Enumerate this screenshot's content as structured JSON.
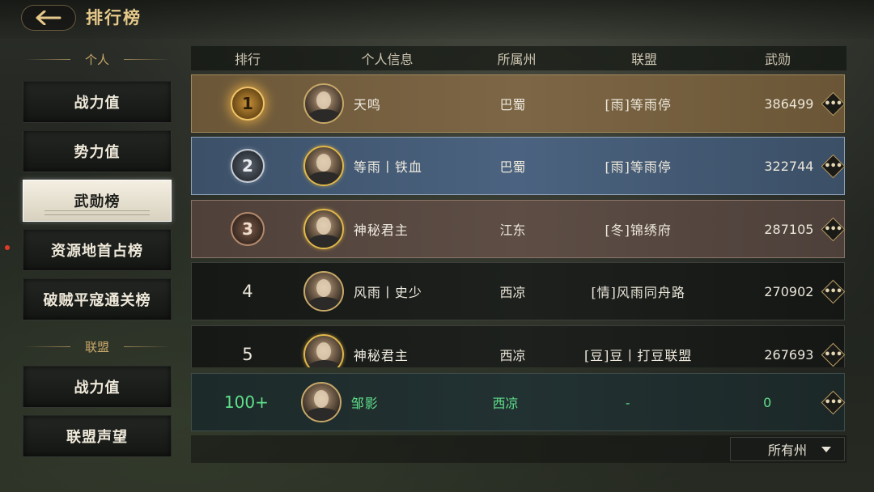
{
  "header": {
    "title": "排行榜"
  },
  "sidebar": {
    "personal_header": "个人",
    "personal_items": [
      {
        "label": "战力值"
      },
      {
        "label": "势力值"
      },
      {
        "label": "武勋榜"
      },
      {
        "label": "资源地首占榜"
      },
      {
        "label": "破贼平寇通关榜"
      }
    ],
    "alliance_header": "联盟",
    "alliance_items": [
      {
        "label": "战力值"
      },
      {
        "label": "联盟声望"
      }
    ],
    "active": "武勋榜"
  },
  "table": {
    "columns": [
      "排行",
      "个人信息",
      "所属州",
      "联盟",
      "武勋"
    ],
    "rows": [
      {
        "rank": "1",
        "name": "天鸣",
        "state": "巴蜀",
        "alliance": "[雨]等雨停",
        "merit": "386499"
      },
      {
        "rank": "2",
        "name": "等雨丨铁血",
        "state": "巴蜀",
        "alliance": "[雨]等雨停",
        "merit": "322744"
      },
      {
        "rank": "3",
        "name": "神秘君主",
        "state": "江东",
        "alliance": "[冬]锦绣府",
        "merit": "287105"
      },
      {
        "rank": "4",
        "name": "风雨丨史少",
        "state": "西凉",
        "alliance": "[情]风雨同舟路",
        "merit": "270902"
      },
      {
        "rank": "5",
        "name": "神秘君主",
        "state": "西凉",
        "alliance": "[豆]豆丨打豆联盟",
        "merit": "267693"
      }
    ],
    "self_row": {
      "rank": "100+",
      "name": "邹影",
      "state": "西凉",
      "alliance": "-",
      "merit": "0"
    },
    "more_label": "•••"
  },
  "filter": {
    "selected": "所有州"
  },
  "colors": {
    "gold_accent": "#c9a86a",
    "self_green": "#5fe08a",
    "notice_red": "#e23a2a"
  },
  "icons": [
    "back-arrow-icon",
    "more-options-icon",
    "dropdown-arrow-icon",
    "rank-medal-icon"
  ]
}
